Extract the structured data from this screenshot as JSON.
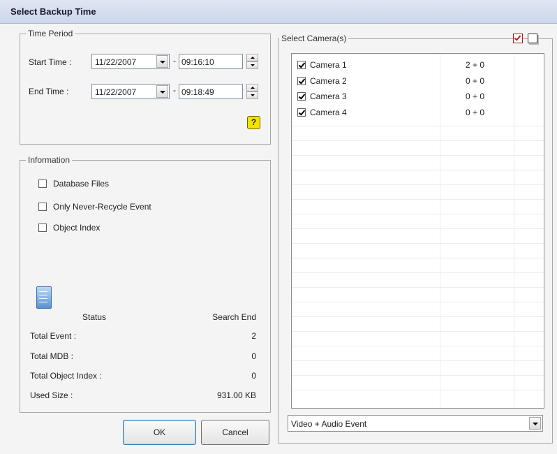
{
  "window": {
    "title": "Select Backup Time"
  },
  "time_period": {
    "legend": "Time Period",
    "start_label": "Start Time :",
    "start_date": "11/22/2007",
    "start_time": "09:16:10",
    "end_label": "End Time :",
    "end_date": "11/22/2007",
    "end_time": "09:18:49",
    "separator": "-"
  },
  "information": {
    "legend": "Information",
    "options": [
      {
        "label": "Database Files",
        "checked": false
      },
      {
        "label": "Only Never-Recycle Event",
        "checked": false
      },
      {
        "label": "Object Index",
        "checked": false
      }
    ],
    "status_label": "Status",
    "status_value": "Search End",
    "rows": [
      {
        "label": "Total Event :",
        "value": "2"
      },
      {
        "label": "Total MDB :",
        "value": "0"
      },
      {
        "label": "Total Object Index :",
        "value": "0"
      },
      {
        "label": "Used Size :",
        "value": "931.00 KB"
      }
    ]
  },
  "buttons": {
    "ok": "OK",
    "cancel": "Cancel"
  },
  "cameras": {
    "legend": "Select Camera(s)",
    "items": [
      {
        "name": "Camera 1",
        "count": "2 + 0",
        "checked": true
      },
      {
        "name": "Camera 2",
        "count": "0 + 0",
        "checked": true
      },
      {
        "name": "Camera 3",
        "count": "0 + 0",
        "checked": true
      },
      {
        "name": "Camera 4",
        "count": "0 + 0",
        "checked": true
      }
    ],
    "event_type": "Video + Audio Event"
  },
  "icons": {
    "help": "help-icon",
    "select_all": "select-all-icon",
    "select_none": "select-none-icon",
    "status": "status-icon",
    "check": "check-icon"
  },
  "colors": {
    "help": "#f2e300",
    "select_all": "#c01b1b",
    "titlebar": "#cdd7ea"
  }
}
